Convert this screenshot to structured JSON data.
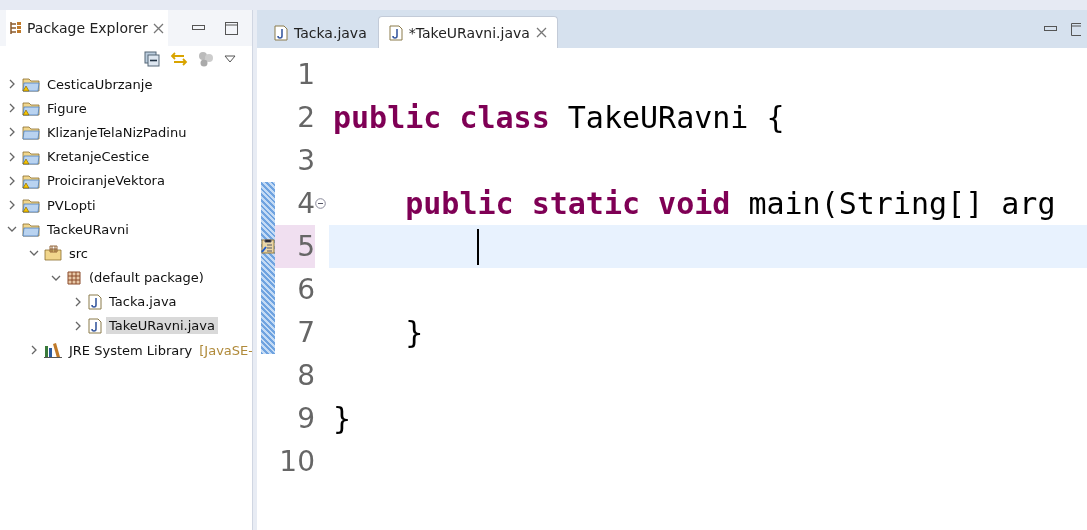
{
  "explorer": {
    "title": "Package Explorer",
    "tree": [
      {
        "label": "CesticaUbrzanje",
        "kind": "warning-project",
        "expanded": false,
        "selected": false
      },
      {
        "label": "Figure",
        "kind": "warning-project",
        "expanded": false,
        "selected": false
      },
      {
        "label": "KlizanjeTelaNizPadinu",
        "kind": "project",
        "expanded": false,
        "selected": false
      },
      {
        "label": "KretanjeCestice",
        "kind": "warning-project",
        "expanded": false,
        "selected": false
      },
      {
        "label": "ProiciranjeVektora",
        "kind": "warning-project",
        "expanded": false,
        "selected": false
      },
      {
        "label": "PVLopti",
        "kind": "warning-project",
        "expanded": false,
        "selected": false
      },
      {
        "label": "TackeURavni",
        "kind": "project",
        "expanded": true,
        "selected": false,
        "children": [
          {
            "label": "src",
            "kind": "src",
            "expanded": true,
            "selected": false,
            "children": [
              {
                "label": "(default package)",
                "kind": "package",
                "expanded": true,
                "selected": false,
                "children": [
                  {
                    "label": "Tacka.java",
                    "kind": "java",
                    "expanded": false,
                    "selected": false
                  },
                  {
                    "label": "TakeURavni.java",
                    "kind": "java",
                    "expanded": false,
                    "selected": true
                  }
                ]
              }
            ]
          },
          {
            "label": "JRE System Library",
            "suffix": "[JavaSE-",
            "kind": "library",
            "expanded": false,
            "selected": false
          }
        ]
      }
    ]
  },
  "editor": {
    "tabs": [
      {
        "label": "Tacka.java",
        "selected": false
      },
      {
        "label": "*TakeURavni.java",
        "selected": true
      }
    ],
    "lines": [
      {
        "number": "1",
        "current": false
      },
      {
        "number": "2",
        "current": false,
        "tokens": [
          {
            "text": "public class",
            "kind": "keyword"
          },
          {
            "text": " TakeURavni {",
            "kind": "plain"
          }
        ]
      },
      {
        "number": "3",
        "current": false
      },
      {
        "number": "4",
        "current": false,
        "fold": true,
        "tokens": [
          {
            "text": "    public static void",
            "kind": "keyword"
          },
          {
            "text": " main(String[] arg",
            "kind": "plain"
          }
        ]
      },
      {
        "number": "5",
        "current": true,
        "task": true,
        "caret": true
      },
      {
        "number": "6",
        "current": false
      },
      {
        "number": "7",
        "current": false,
        "tokens": [
          {
            "text": "    }",
            "kind": "plain"
          }
        ]
      },
      {
        "number": "8",
        "current": false
      },
      {
        "number": "9",
        "current": false,
        "tokens": [
          {
            "text": "}",
            "kind": "plain"
          }
        ]
      },
      {
        "number": "10",
        "current": false
      }
    ]
  }
}
